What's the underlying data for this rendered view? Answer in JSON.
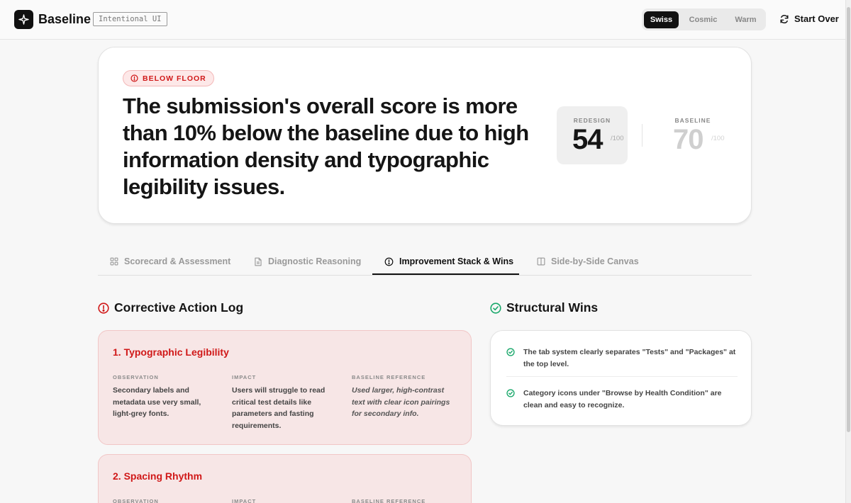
{
  "header": {
    "brand": "Baseline",
    "tag": "Intentional UI",
    "themes": [
      {
        "label": "Swiss",
        "active": true
      },
      {
        "label": "Cosmic",
        "active": false
      },
      {
        "label": "Warm",
        "active": false
      }
    ],
    "start_over": "Start Over"
  },
  "hero": {
    "status": "BELOW FLOOR",
    "headline": "The submission's overall score is more than 10% below the baseline due to high information density and typographic legibility issues.",
    "redesign": {
      "label": "REDESIGN",
      "value": "54",
      "max": "/100"
    },
    "baseline": {
      "label": "BASELINE",
      "value": "70",
      "max": "/100"
    }
  },
  "tabs": [
    {
      "label": "Scorecard & Assessment",
      "icon": "grid-icon",
      "active": false
    },
    {
      "label": "Diagnostic Reasoning",
      "icon": "document-icon",
      "active": false
    },
    {
      "label": "Improvement Stack & Wins",
      "icon": "alert-circle-icon",
      "active": true
    },
    {
      "label": "Side-by-Side Canvas",
      "icon": "columns-icon",
      "active": false
    }
  ],
  "corrective": {
    "title": "Corrective Action Log",
    "col_labels": {
      "observation": "OBSERVATION",
      "impact": "IMPACT",
      "reference": "BASELINE REFERENCE"
    },
    "items": [
      {
        "title": "1. Typographic Legibility",
        "observation": "Secondary labels and metadata use very small, light-grey fonts.",
        "impact": "Users will struggle to read critical test details like parameters and fasting requirements.",
        "reference": "Used larger, high-contrast text with clear icon pairings for secondary info."
      },
      {
        "title": "2. Spacing Rhythm",
        "observation": "",
        "impact": "",
        "reference": ""
      }
    ]
  },
  "wins": {
    "title": "Structural Wins",
    "items": [
      "The tab system clearly separates \"Tests\" and \"Packages\" at the top level.",
      "Category icons under \"Browse by Health Condition\" are clean and easy to recognize."
    ]
  },
  "colors": {
    "accent_red": "#d01818",
    "accent_green": "#1aa86b",
    "ink": "#151515"
  }
}
